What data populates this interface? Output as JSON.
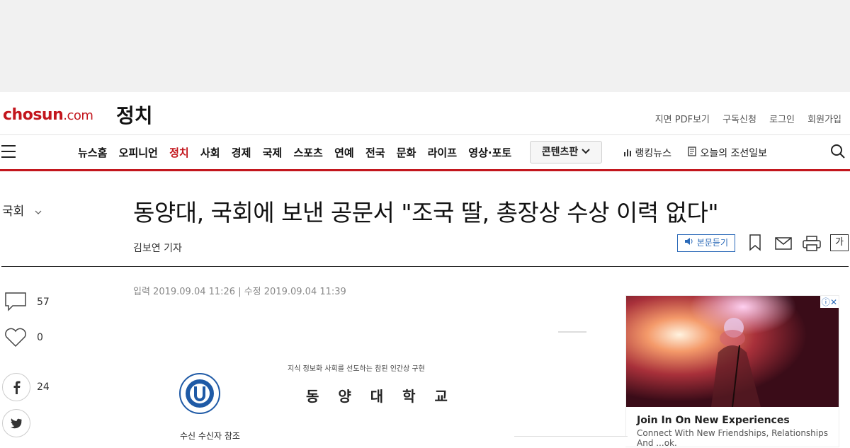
{
  "header": {
    "logo_main": "chosun",
    "logo_suffix": ".com",
    "section": "정치",
    "util_links": [
      "지면 PDF보기",
      "구독신청",
      "로그인",
      "회원가입"
    ]
  },
  "nav": {
    "items": [
      "뉴스홈",
      "오피니언",
      "정치",
      "사회",
      "경제",
      "국제",
      "스포츠",
      "연예",
      "전국",
      "문화",
      "라이프",
      "영상·포토"
    ],
    "active": "정치",
    "content_button": "콘텐츠판",
    "ranking": "랭킹뉴스",
    "today": "오늘의 조선일보"
  },
  "article": {
    "category": "국회",
    "title": "동양대, 국회에 보낸 공문서 \"조국 딸, 총장상 수상 이력 없다\"",
    "byline": "김보연 기자",
    "listen": "본문듣기",
    "font_button": "가",
    "dates": "입력 2019.09.04 11:26 | 수정 2019.09.04 11:39"
  },
  "side": {
    "comments": "57",
    "likes": "0",
    "facebook": "24"
  },
  "document": {
    "slogan": "지식 정보화 사회를 선도하는 참된 인간상 구현",
    "school": "동 양 대 학 교",
    "receiver": "수신   수신자 참조"
  },
  "ad": {
    "title": "Join In On New Experiences",
    "desc": "Connect With New Friendships, Relationships And ...ok."
  },
  "colors": {
    "brand": "#c3161d",
    "accent_blue": "#2b6ab8"
  }
}
